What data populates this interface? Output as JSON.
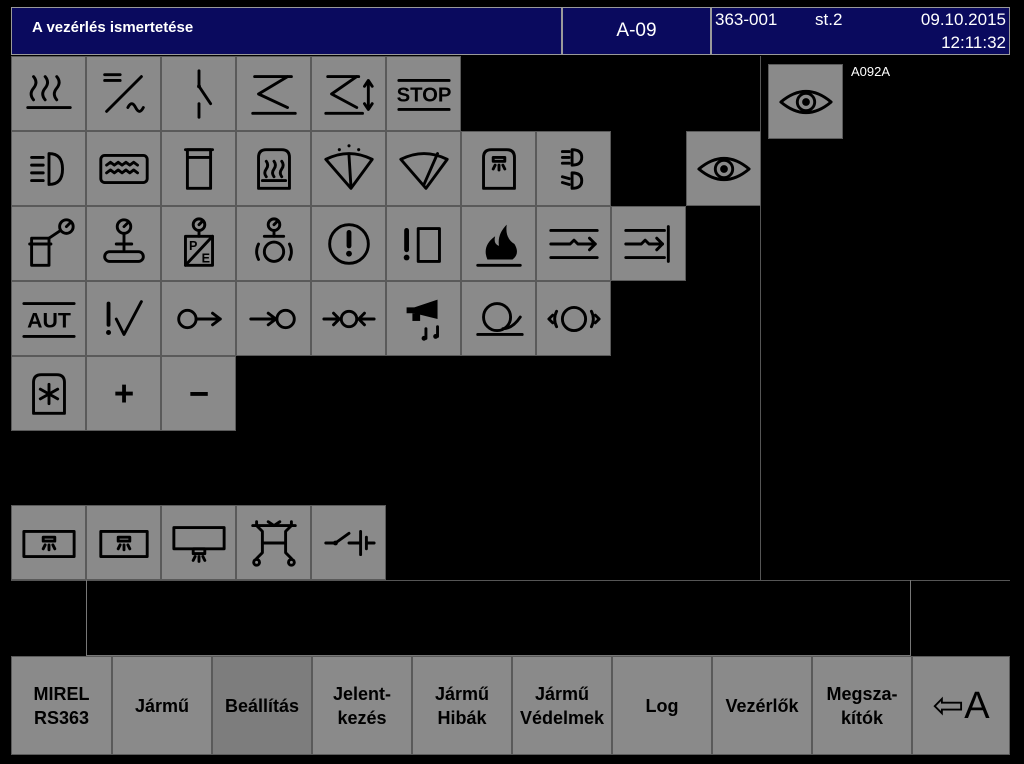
{
  "header": {
    "title": "A vezérlés ismertetése",
    "screen_code": "A-09",
    "unit": "363-001",
    "station": "st.2",
    "date": "09.10.2015",
    "time": "12:11:32"
  },
  "preview": {
    "label": "A092A",
    "icon": "eye-icon"
  },
  "icon_rows": [
    [
      "heater-icon",
      "dc-ac-converter-icon",
      "switch-icon",
      "pantograph-icon",
      "pantograph-updown-icon",
      "stop-icon"
    ],
    [
      "headlight-icon",
      "heating-panel-icon",
      "cabinet-icon",
      "cab-heater-icon",
      "wiper-spray-icon",
      "wiper-icon",
      "cab-light-icon",
      "headlight-beam-icon",
      "eye-icon"
    ],
    [
      "pressure-tank-icon",
      "brake-pressure-icon",
      "pressure-pe-icon",
      "wheel-pressure-icon",
      "warning-circle-icon",
      "warning-box-icon",
      "fire-icon",
      "coupling-icon",
      "coupling-end-icon"
    ],
    [
      "aut-icon",
      "check-icon",
      "brake-release-icon",
      "brake-apply-icon",
      "brake-both-icon",
      "horn-icon",
      "sanding-icon",
      "wheel-slip-icon"
    ],
    [
      "ac-snowflake-icon",
      "plus-icon",
      "minus-icon"
    ],
    [
      "interior-light-icon",
      "interior-light-small-icon",
      "roof-light-icon",
      "bogie-icon",
      "battery-switch-icon"
    ]
  ],
  "icon_text": {
    "stop": "STOP",
    "aut": "AUT",
    "plus": "+",
    "minus": "−",
    "p": "P",
    "e": "E"
  },
  "nav": [
    {
      "id": "mirel",
      "label": "MIREL\nRS363"
    },
    {
      "id": "jarmu",
      "label": "Jármű"
    },
    {
      "id": "beallitas",
      "label": "Beállítás"
    },
    {
      "id": "jelentkezes",
      "label": "Jelent-\nkezés"
    },
    {
      "id": "jarmu-hibak",
      "label": "Jármű\nHibák"
    },
    {
      "id": "jarmu-vedelmek",
      "label": "Jármű\nVédelmek"
    },
    {
      "id": "log",
      "label": "Log"
    },
    {
      "id": "vezerlok",
      "label": "Vezérlők"
    },
    {
      "id": "megszakitok",
      "label": "Megsza-\nkítók"
    },
    {
      "id": "back",
      "label": "⇦A"
    }
  ],
  "colors": {
    "header_bg": "#0a0a5e",
    "tile_bg": "#8a8a8a",
    "background": "#000000"
  }
}
